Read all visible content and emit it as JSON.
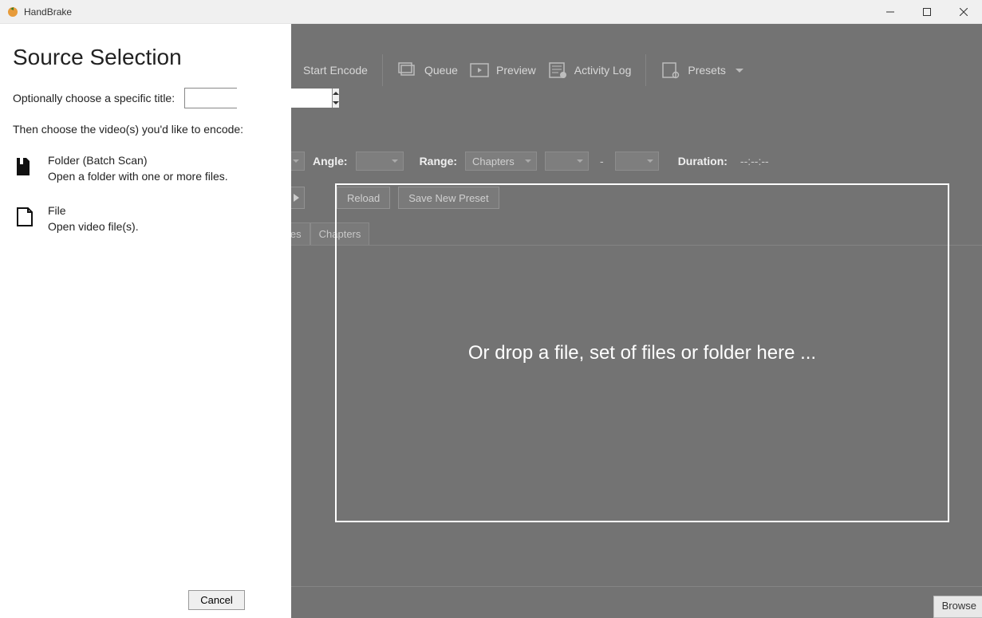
{
  "titlebar": {
    "title": "HandBrake"
  },
  "toolbar": {
    "start_encode": "Start Encode",
    "queue": "Queue",
    "preview": "Preview",
    "activity_log": "Activity Log",
    "presets": "Presets"
  },
  "options": {
    "angle_label": "Angle:",
    "range_label": "Range:",
    "range_value": "Chapters",
    "range_sep": "-",
    "duration_label": "Duration:",
    "duration_value": "--:--:--"
  },
  "actions": {
    "reload": "Reload",
    "save_new_preset": "Save New Preset"
  },
  "tabs": {
    "subtitles_partial": "les",
    "chapters": "Chapters"
  },
  "bottom": {
    "browse": "Browse"
  },
  "panel": {
    "heading": "Source Selection",
    "title_label": "Optionally choose a specific title:",
    "title_value": "",
    "instruction": "Then choose the video(s) you'd like to encode:",
    "folder_title": "Folder (Batch Scan)",
    "folder_sub": "Open a folder with one or more files.",
    "file_title": "File",
    "file_sub": "Open video file(s).",
    "cancel": "Cancel"
  },
  "dropzone": {
    "text": "Or drop a file, set of files or folder here ..."
  }
}
